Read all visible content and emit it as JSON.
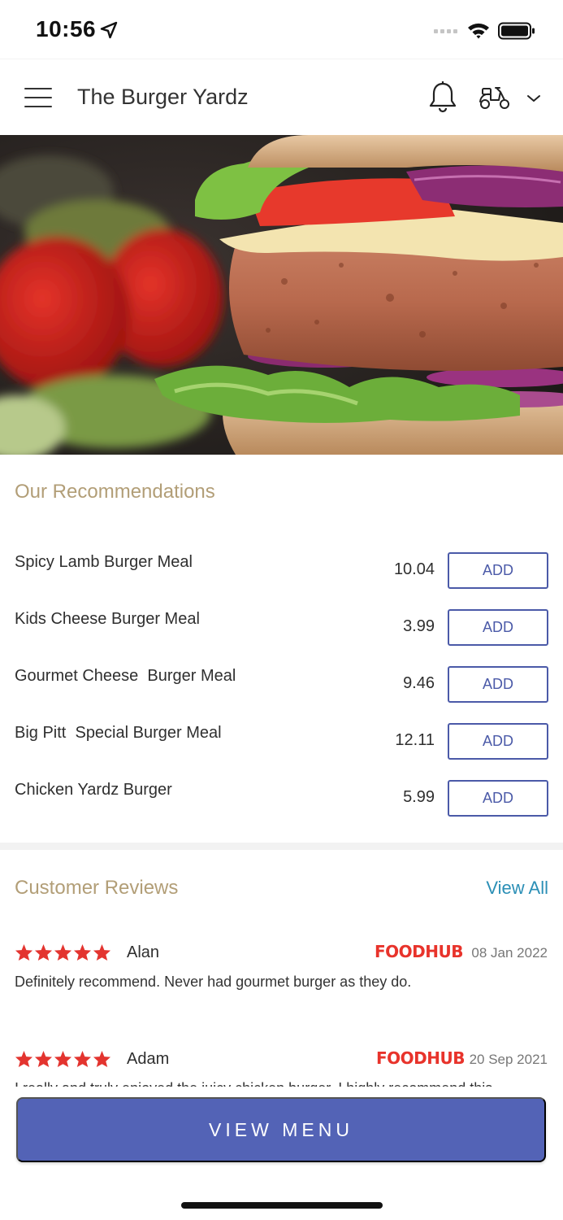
{
  "status_bar": {
    "time": "10:56"
  },
  "header": {
    "title": "The Burger Yardz"
  },
  "recommendations": {
    "title": "Our Recommendations",
    "add_label": "ADD",
    "items": [
      {
        "name": "Spicy Lamb Burger Meal",
        "price": "10.04"
      },
      {
        "name": "Kids Cheese Burger Meal",
        "price": "3.99"
      },
      {
        "name": "Gourmet Cheese  Burger Meal",
        "price": "9.46"
      },
      {
        "name": "Big Pitt  Special Burger Meal",
        "price": "12.11"
      },
      {
        "name": "Chicken Yardz Burger",
        "price": "5.99"
      }
    ]
  },
  "reviews": {
    "title": "Customer Reviews",
    "view_all": "View All",
    "items": [
      {
        "name": "Alan",
        "rating": 5,
        "source": "FOODHUB",
        "date": "08 Jan 2022",
        "text": "Definitely recommend. Never had gourmet burger as they do."
      },
      {
        "name": "Adam",
        "rating": 5,
        "source": "FOODHUB",
        "date": "20 Sep 2021",
        "text": "I really and truly enjoyed the juicy chicken burger. I highly recommend this"
      }
    ]
  },
  "footer": {
    "view_menu": "VIEW MENU"
  },
  "colors": {
    "accent": "#5363b6",
    "section_title": "#b29e77",
    "link": "#2b8fb6",
    "star": "#e3342f",
    "foodhub": "#e8332b"
  },
  "icons": [
    "location-arrow-icon",
    "signal-icon",
    "wifi-icon",
    "battery-icon",
    "hamburger-menu-icon",
    "bell-icon",
    "scooter-icon",
    "chevron-down-icon",
    "star-icon"
  ]
}
